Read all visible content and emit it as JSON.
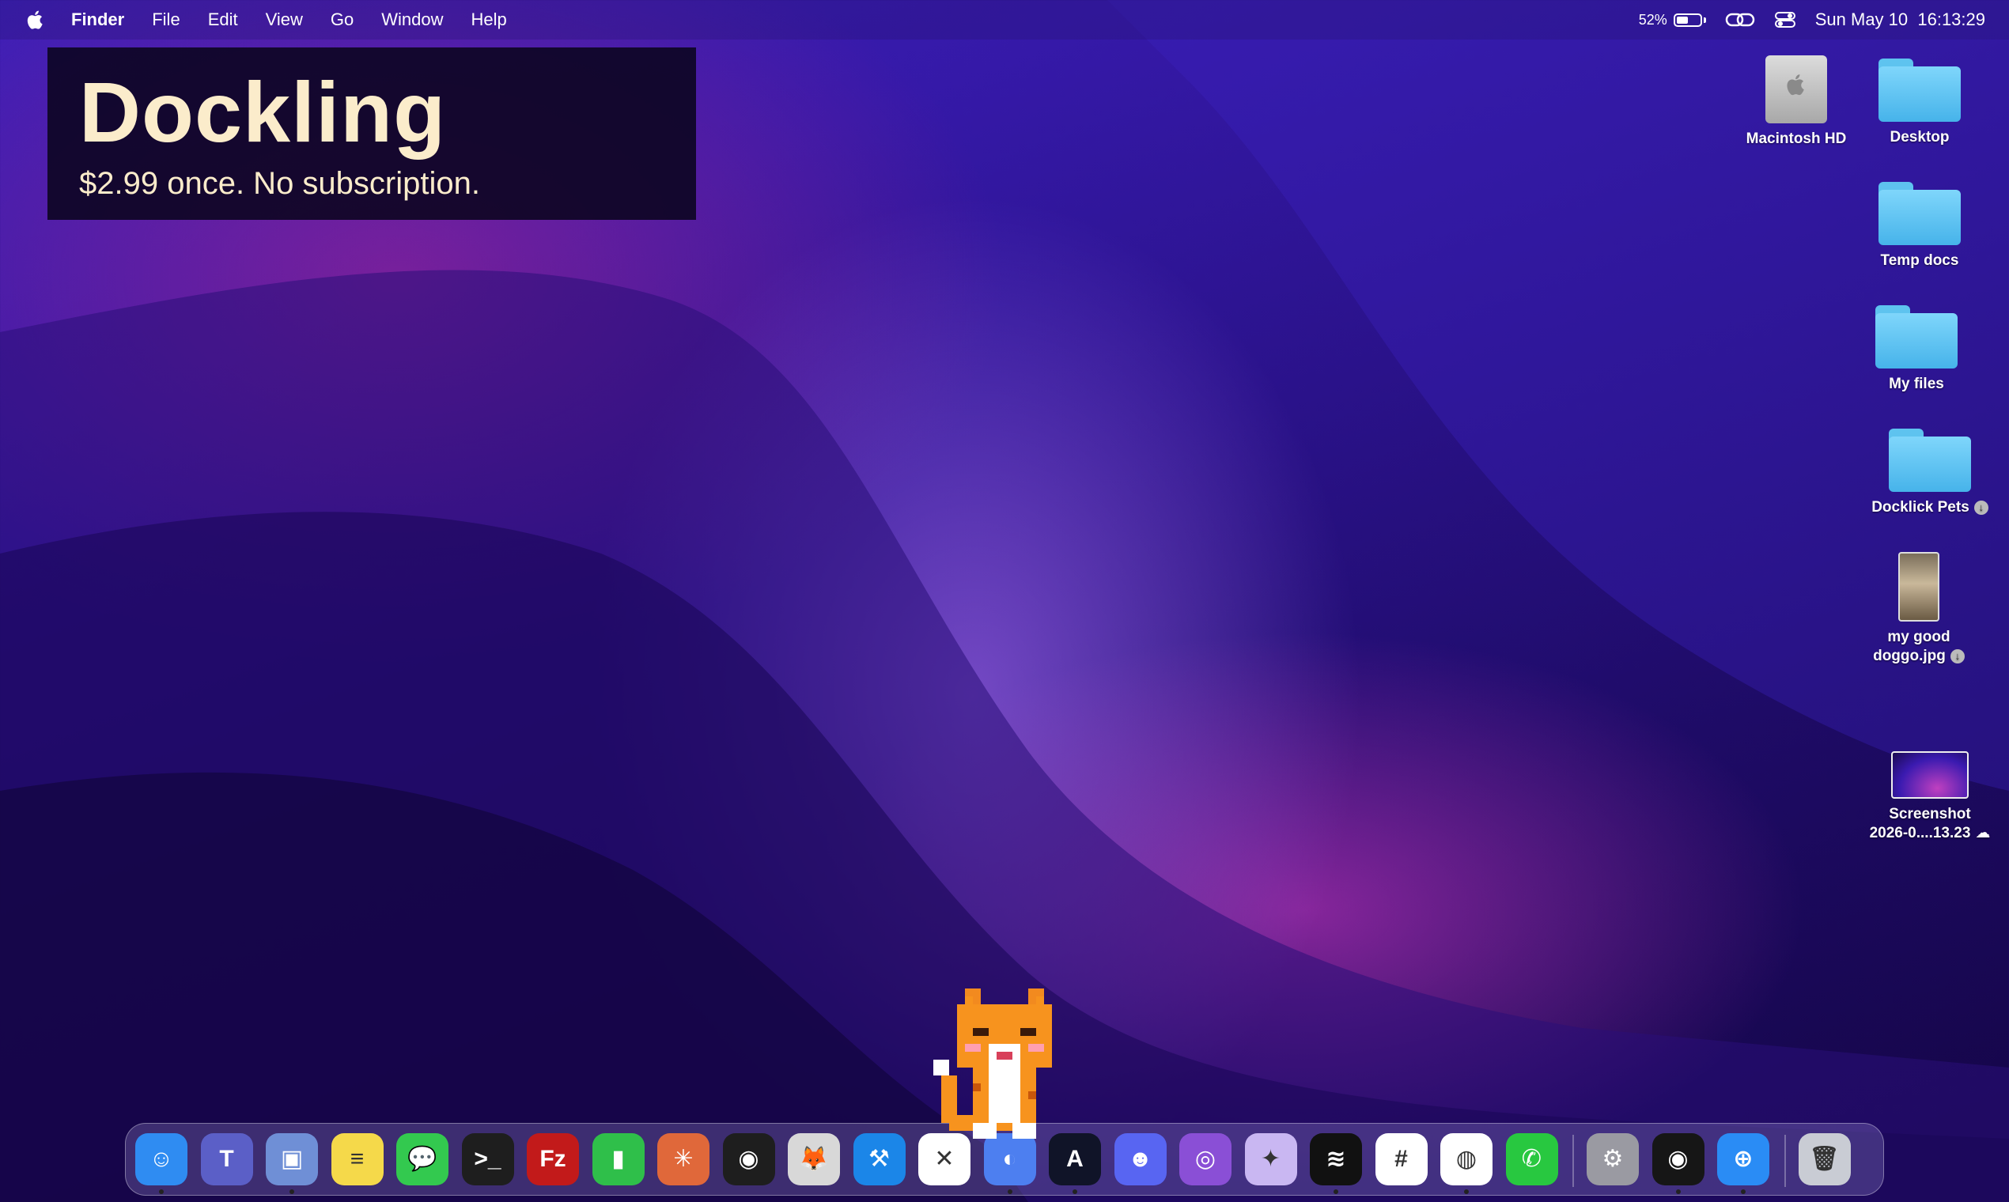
{
  "menubar": {
    "app_name": "Finder",
    "menus": [
      "File",
      "Edit",
      "View",
      "Go",
      "Window",
      "Help"
    ],
    "battery_percent": "52%",
    "battery_level": 0.52,
    "datetime": "Sun May 10  16:13:29"
  },
  "banner": {
    "title": "Dockling",
    "subtitle": "$2.99 once. No subscription."
  },
  "desktop_icons": [
    {
      "label": "Macintosh HD"
    },
    {
      "label": "Desktop"
    },
    {
      "label": "Temp docs"
    },
    {
      "label": "My files"
    },
    {
      "label": "Docklick Pets"
    },
    {
      "label": "my good doggo.jpg"
    },
    {
      "label_line1": "Screenshot",
      "label_line2": "2026-0....13.23"
    }
  ],
  "dock": {
    "apps": [
      {
        "name": "finder-app-icon",
        "color": "#2f8cf2",
        "glyph": "☺",
        "running": true
      },
      {
        "name": "teams-app-icon",
        "color": "#5b5fc7",
        "glyph": "T",
        "running": false
      },
      {
        "name": "storage-app-icon",
        "color": "#6f8fd6",
        "glyph": "▣",
        "running": true
      },
      {
        "name": "notes-app-icon",
        "color": "#f5d94a",
        "glyph": "≡",
        "running": false
      },
      {
        "name": "messages-app-icon",
        "color": "#33c94f",
        "glyph": "💬",
        "running": false
      },
      {
        "name": "terminal-app-icon",
        "color": "#1e1e1e",
        "glyph": ">_",
        "running": false
      },
      {
        "name": "filezilla-app-icon",
        "color": "#c21a1a",
        "glyph": "Fz",
        "running": false
      },
      {
        "name": "numbers-app-icon",
        "color": "#2fbf4a",
        "glyph": "▮",
        "running": false
      },
      {
        "name": "claude-app-icon",
        "color": "#e0683a",
        "glyph": "✳",
        "running": false
      },
      {
        "name": "figma-app-icon",
        "color": "#1e1e1e",
        "glyph": "◉",
        "running": false
      },
      {
        "name": "red-panda-app-icon",
        "color": "#d8d8d8",
        "glyph": "🦊",
        "running": false
      },
      {
        "name": "xcode-app-icon",
        "color": "#1b86e8",
        "glyph": "⚒",
        "running": false
      },
      {
        "name": "capcut-app-icon",
        "color": "#ffffff",
        "glyph": "✕",
        "running": false
      },
      {
        "name": "dockling-app-icon",
        "color": "#4d7ff0",
        "glyph": "◐",
        "running": true
      },
      {
        "name": "affinity-app-icon",
        "color": "#101428",
        "glyph": "A",
        "running": true
      },
      {
        "name": "discord-app-icon",
        "color": "#5865f2",
        "glyph": "☻",
        "running": false
      },
      {
        "name": "github-app-icon",
        "color": "#8a4fd6",
        "glyph": "◎",
        "running": false
      },
      {
        "name": "creative-app-icon",
        "color": "#c9b7f2",
        "glyph": "✦",
        "running": false
      },
      {
        "name": "spotify-app-icon",
        "color": "#111111",
        "glyph": "≋",
        "running": true
      },
      {
        "name": "slack-app-icon",
        "color": "#ffffff",
        "glyph": "#",
        "running": false
      },
      {
        "name": "chrome-app-icon",
        "color": "#ffffff",
        "glyph": "◍",
        "running": true
      },
      {
        "name": "whatsapp-app-icon",
        "color": "#28c840",
        "glyph": "✆",
        "running": false
      },
      {
        "name": "system-settings-app-icon",
        "color": "#9a9aa2",
        "glyph": "⚙",
        "running": false
      },
      {
        "name": "lens-app-icon",
        "color": "#161616",
        "glyph": "◉",
        "running": true
      },
      {
        "name": "safari-app-icon",
        "color": "#2a8cf5",
        "glyph": "⊕",
        "running": true
      },
      {
        "name": "trash-icon",
        "color": "#c9ccd4",
        "glyph": "🗑",
        "running": false
      }
    ]
  },
  "colors": {
    "banner_text": "#fbeccb",
    "folder_blue": "#5ec3ef"
  }
}
